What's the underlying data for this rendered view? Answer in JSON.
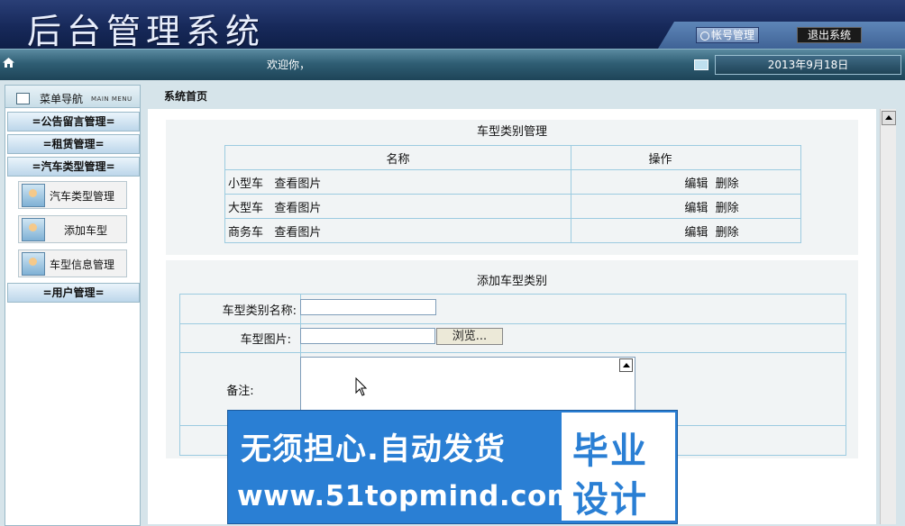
{
  "header": {
    "title": "后台管理系统",
    "account_button": "帐号管理",
    "logout_button": "退出系统"
  },
  "welcome_bar": {
    "text": "欢迎你，",
    "date": "2013年9月18日"
  },
  "sidebar": {
    "title": "菜单导航",
    "subtitle": "MAIN MENU",
    "groups": [
      {
        "label": "=公告留言管理="
      },
      {
        "label": "=租赁管理="
      },
      {
        "label": "=汽车类型管理="
      },
      {
        "label": "=用户管理="
      }
    ],
    "items": [
      {
        "label": "汽车类型管理",
        "icon": "user-icon"
      },
      {
        "label": "添加车型",
        "icon": "user-icon"
      },
      {
        "label": "车型信息管理",
        "icon": "user-icon"
      }
    ]
  },
  "breadcrumb": "系统首页",
  "list_panel": {
    "title": "车型类别管理",
    "columns": [
      "名称",
      "操作"
    ],
    "view_link": "查看图片",
    "edit_link": "编辑",
    "delete_link": "删除",
    "rows": [
      {
        "name": "小型车"
      },
      {
        "name": "大型车"
      },
      {
        "name": "商务车"
      }
    ]
  },
  "form_panel": {
    "title": "添加车型类别",
    "name_label": "车型类别名称:",
    "name_value": "",
    "image_label": "车型图片:",
    "image_value": "",
    "browse_button": "浏览...",
    "remark_label": "备注:",
    "remark_value": ""
  },
  "watermark": {
    "line1": "无须担心.自动发货",
    "line2": "www.51topmind.com",
    "box_line1": "毕业",
    "box_line2": "设计"
  },
  "colors": {
    "banner": "#17295a",
    "welcome_bar": "#2f5e74",
    "watermark_blue": "#2a7fd4",
    "table_border": "#9ccbe0"
  }
}
